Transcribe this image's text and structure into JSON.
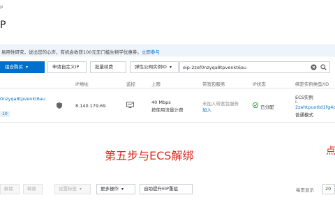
{
  "breadcrumb": "P",
  "page_title": "P",
  "notice": {
    "text": "易用性研究，说出您的心声，有机会收获100元无门槛生物学优惠券。",
    "link": "立即参与"
  },
  "toolbar": {
    "buy_label": "组合购买",
    "apply_label": "申请自定义IP",
    "renew_label": "批量续费",
    "filter_label": "弹性公网实例ID",
    "search_value": "eip-2zef0nzyqa8tpvenkt6au"
  },
  "table": {
    "headers": [
      "IP地址",
      "监控",
      "上限",
      "带宽包服务",
      "IP状态",
      "绑定实例类型/ID"
    ],
    "row": {
      "id": "0nzyqa8tpvenkt6au",
      "tag": "10",
      "ip": "8.140.179.69",
      "bandwidth": "40 Mbps",
      "billing": "按使用流量计费",
      "pkg_status": "未加入带宽包服务",
      "pkg_link": "加入",
      "ip_status": "已分配",
      "instance_type": "ECS实例",
      "instance_dash": "i-",
      "instance_id": "2zehtpuottd1fg4dg",
      "instance_mode": "普通模式"
    }
  },
  "overlay": {
    "main": "第五步与ECS解绑",
    "edge": "点"
  },
  "footer": {
    "release": "解除",
    "unbind": "释放",
    "set_label": "设置标签",
    "more": "更多操作",
    "auto_upgrade": "自助提升EIP重组",
    "page_size_label": "每页显示",
    "page_size": "20"
  },
  "colors": {
    "primary": "#0070cc",
    "overlay_red": "#e0281f",
    "notice_bg": "#eef4fb",
    "status_green": "#2e9a3e"
  },
  "icons": {
    "caret": "chevron-down-icon",
    "search": "search-icon",
    "clear": "clear-icon",
    "shield": "shield-icon",
    "monitor": "monitor-icon",
    "status": "check-circle-icon"
  }
}
